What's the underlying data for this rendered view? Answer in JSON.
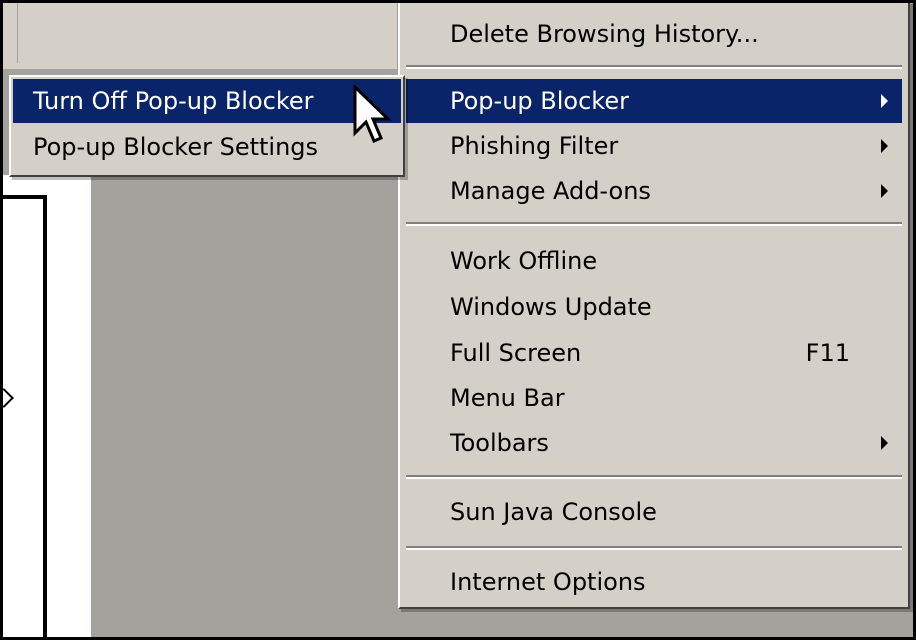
{
  "main_menu": {
    "items": [
      {
        "label": "Delete Browsing History..."
      },
      {
        "label": "Pop-up Blocker"
      },
      {
        "label": "Phishing Filter"
      },
      {
        "label": "Manage Add-ons"
      },
      {
        "label": "Work Offline"
      },
      {
        "label": "Windows Update"
      },
      {
        "label": "Full Screen",
        "shortcut": "F11"
      },
      {
        "label": "Menu Bar"
      },
      {
        "label": "Toolbars"
      },
      {
        "label": "Sun Java Console"
      },
      {
        "label": "Internet Options"
      }
    ]
  },
  "submenu": {
    "items": [
      {
        "label": "Turn Off Pop-up Blocker"
      },
      {
        "label": "Pop-up Blocker Settings"
      }
    ]
  },
  "colors": {
    "menu_bg": "#d4d0c8",
    "highlight": "#0a246a",
    "highlight_text": "#ffffff",
    "page_bg": "#a3a29c"
  },
  "icons": [
    "submenu-arrow-icon",
    "mouse-cursor-icon",
    "chevron-right-icon"
  ]
}
